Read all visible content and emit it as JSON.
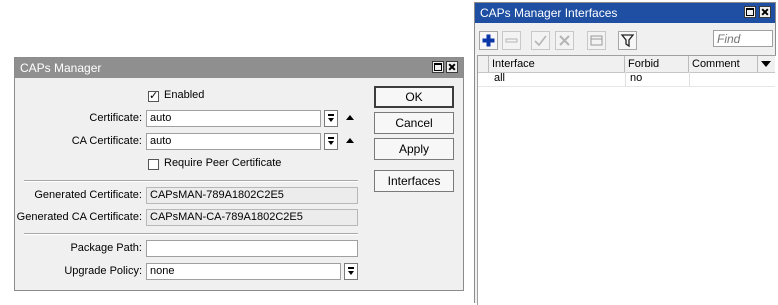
{
  "caps_manager": {
    "title": "CAPs Manager",
    "enabled_label": "Enabled",
    "enabled": true,
    "certificate_label": "Certificate:",
    "certificate_value": "auto",
    "ca_certificate_label": "CA Certificate:",
    "ca_certificate_value": "auto",
    "require_peer_label": "Require Peer Certificate",
    "require_peer": false,
    "generated_cert_label": "Generated Certificate:",
    "generated_cert_value": "CAPsMAN-789A1802C2E5",
    "generated_ca_label": "Generated CA Certificate:",
    "generated_ca_value": "CAPsMAN-CA-789A1802C2E5",
    "package_path_label": "Package Path:",
    "package_path_value": "",
    "upgrade_policy_label": "Upgrade Policy:",
    "upgrade_policy_value": "none",
    "buttons": {
      "ok": "OK",
      "cancel": "Cancel",
      "apply": "Apply",
      "interfaces": "Interfaces"
    },
    "title_color": "#8f8f8f"
  },
  "interfaces_window": {
    "title": "CAPs Manager Interfaces",
    "find_placeholder": "Find",
    "columns": {
      "interface": "Interface",
      "forbid": "Forbid",
      "comment": "Comment"
    },
    "rows": [
      {
        "interface": "all",
        "forbid": "no",
        "comment": ""
      }
    ],
    "toolbar_icons": [
      "plus-icon",
      "minus-icon",
      "check-icon",
      "cross-icon",
      "comment-icon",
      "filter-icon"
    ],
    "title_color": "#1e4fa3",
    "accent_color": "#0b36a8"
  }
}
